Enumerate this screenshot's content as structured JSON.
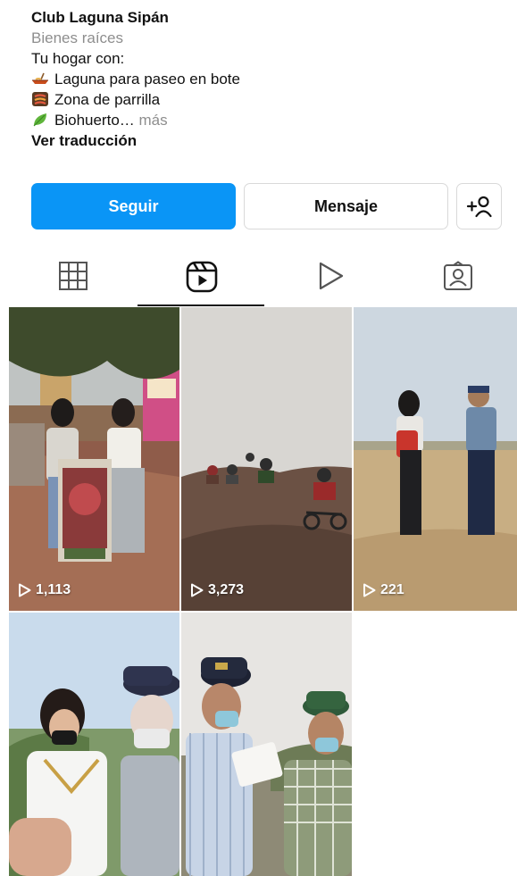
{
  "profile": {
    "name": "Club Laguna Sipán",
    "category": "Bienes raíces",
    "bio_intro": "Tu hogar con:",
    "bio_items": [
      {
        "icon": "canoe-icon",
        "text": "Laguna para paseo en bote"
      },
      {
        "icon": "grill-icon",
        "text": "Zona de parrilla"
      },
      {
        "icon": "leaf-icon",
        "text": "Biohuerto…"
      }
    ],
    "more_label": "más",
    "translate_label": "Ver traducción"
  },
  "actions": {
    "follow_label": "Seguir",
    "message_label": "Mensaje",
    "add_person_label": "+"
  },
  "tabs": [
    {
      "name": "grid",
      "icon": "grid-icon"
    },
    {
      "name": "reels",
      "icon": "reels-icon",
      "active": true
    },
    {
      "name": "videos",
      "icon": "play-icon"
    },
    {
      "name": "tagged",
      "icon": "tagged-user-icon"
    }
  ],
  "reels": [
    {
      "views": "1,113"
    },
    {
      "views": "3,273"
    },
    {
      "views": "221"
    },
    {
      "views": ""
    },
    {
      "views": ""
    }
  ],
  "colors": {
    "accent": "#0a95f6",
    "muted": "#8e8e8e"
  }
}
